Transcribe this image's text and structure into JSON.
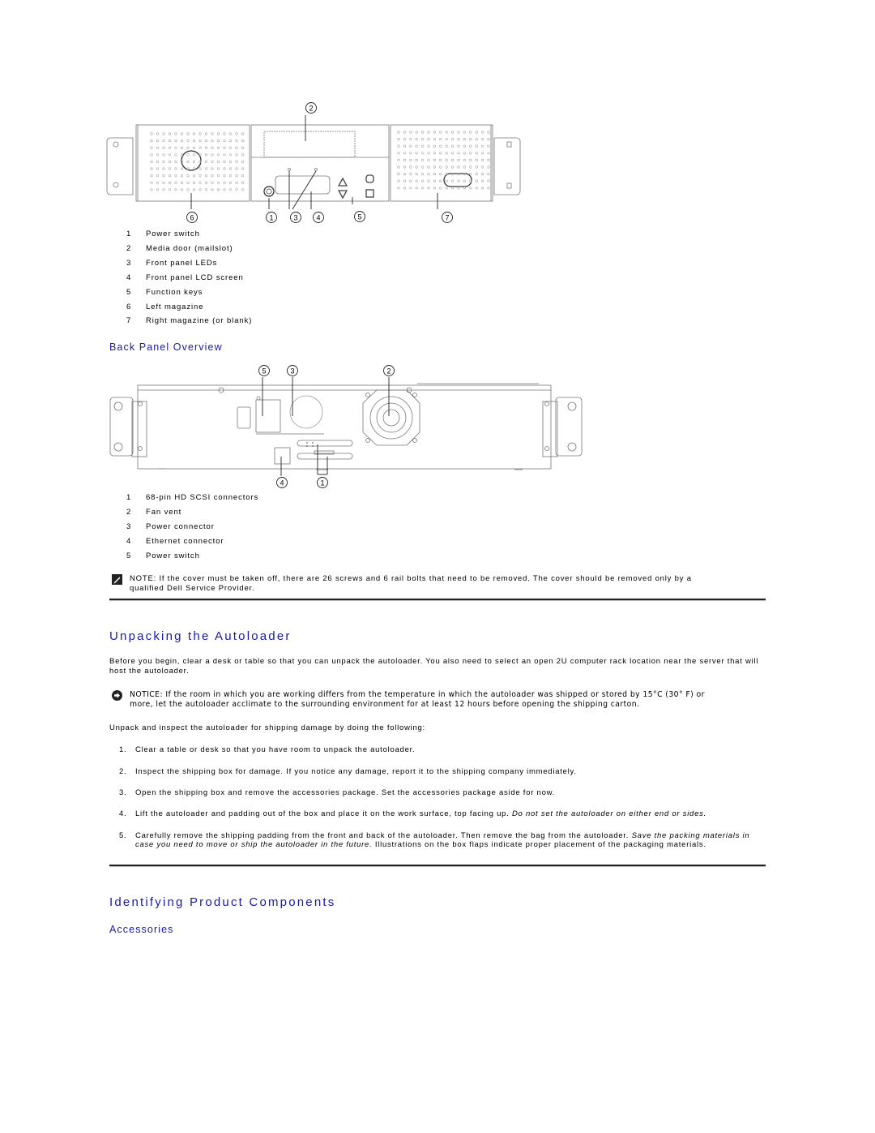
{
  "front_panel": {
    "diagram_callouts": [
      "2",
      "6",
      "1",
      "3",
      "4",
      "5",
      "7"
    ],
    "legend": [
      {
        "num": "1",
        "label": "Power switch"
      },
      {
        "num": "2",
        "label": "Media door (mailslot)"
      },
      {
        "num": "3",
        "label": "Front panel LEDs"
      },
      {
        "num": "4",
        "label": "Front panel LCD screen"
      },
      {
        "num": "5",
        "label": "Function keys"
      },
      {
        "num": "6",
        "label": "Left magazine"
      },
      {
        "num": "7",
        "label": "Right magazine (or blank)"
      }
    ]
  },
  "back_panel": {
    "heading": "Back Panel Overview",
    "diagram_callouts": [
      "5",
      "3",
      "2",
      "4",
      "1"
    ],
    "legend": [
      {
        "num": "1",
        "label": "68-pin HD SCSI connectors"
      },
      {
        "num": "2",
        "label": "Fan vent"
      },
      {
        "num": "3",
        "label": "Power connector"
      },
      {
        "num": "4",
        "label": "Ethernet connector"
      },
      {
        "num": "5",
        "label": "Power switch"
      }
    ],
    "note": "NOTE: If the cover must be taken off, there are 26 screws and 6 rail bolts that need to be removed. The cover should be removed only by a qualified Dell Service Provider."
  },
  "unpacking": {
    "heading": "Unpacking the Autoloader",
    "intro": "Before you begin, clear a desk or table so that you can unpack the autoloader. You also need to select an open 2U computer rack location near the server that will host the autoloader.",
    "notice": "NOTICE: If the room in which you are working differs from the temperature in which the autoloader was shipped or stored by 15°C (30° F) or more, let the autoloader acclimate to the surrounding environment for at least 12 hours before opening the shipping carton.",
    "lead": "Unpack and inspect the autoloader for shipping damage by doing the following:",
    "steps": [
      {
        "num": "1.",
        "text": "Clear a table or desk so that you have room to unpack the autoloader."
      },
      {
        "num": "2.",
        "text": "Inspect the shipping box for damage. If you notice any damage, report it to the shipping company immediately."
      },
      {
        "num": "3.",
        "text": "Open the shipping box and remove the accessories package. Set the accessories package aside for now."
      },
      {
        "num": "4.",
        "text": "Lift the autoloader and padding out of the box and place it on the work surface, top facing up. ",
        "italic": "Do not set the autoloader on either end or sides."
      },
      {
        "num": "5.",
        "text": "Carefully remove the shipping padding from the front and back of the autoloader. Then remove the bag from the autoloader. ",
        "italic": "Save the packing materials in case you need to move or ship the autoloader in the future.",
        "text_after": " Illustrations on the box flaps indicate proper placement of the packaging materials."
      }
    ]
  },
  "components": {
    "heading": "Identifying Product Components",
    "subheading": "Accessories"
  },
  "colors": {
    "heading": "#1a1aa6",
    "text": "#000000",
    "rule": "#222222"
  }
}
